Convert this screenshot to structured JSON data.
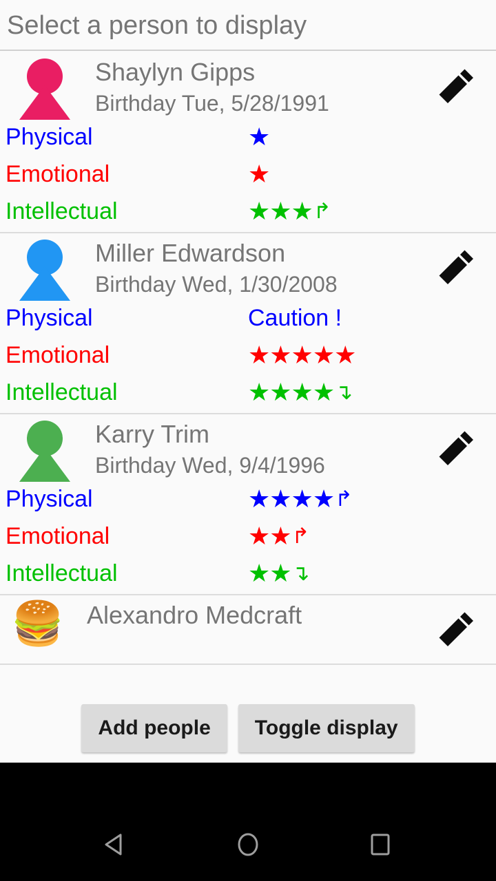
{
  "header": {
    "title": "Select a person to display"
  },
  "attributes": {
    "physical_label": "Physical",
    "emotional_label": "Emotional",
    "intellectual_label": "Intellectual",
    "physical_color": "#0000FF",
    "emotional_color": "#FF0000",
    "intellectual_color": "#00C000"
  },
  "icons": {
    "edit": "pencil-icon",
    "arrow_up": "↱",
    "arrow_down": "↴",
    "star": "★",
    "nav_back": "back-triangle-icon",
    "nav_home": "home-circle-icon",
    "nav_recents": "recents-square-icon"
  },
  "people": [
    {
      "name": "Shaylyn Gipps",
      "birthday": "Birthday Tue, 5/28/1991",
      "avatar_type": "person",
      "avatar_color": "#E91E63",
      "ratings": {
        "physical": {
          "stars": "★",
          "arrow": "",
          "caution": ""
        },
        "emotional": {
          "stars": "★",
          "arrow": "",
          "caution": ""
        },
        "intellectual": {
          "stars": "★★★",
          "arrow": "↱",
          "caution": ""
        }
      }
    },
    {
      "name": "Miller Edwardson",
      "birthday": "Birthday Wed, 1/30/2008",
      "avatar_type": "person",
      "avatar_color": "#2196F3",
      "ratings": {
        "physical": {
          "stars": "",
          "arrow": "",
          "caution": "Caution !"
        },
        "emotional": {
          "stars": "★★★★★",
          "arrow": "",
          "caution": ""
        },
        "intellectual": {
          "stars": "★★★★",
          "arrow": "↴",
          "caution": ""
        }
      }
    },
    {
      "name": "Karry Trim",
      "birthday": "Birthday Wed, 9/4/1996",
      "avatar_type": "person",
      "avatar_color": "#4CAF50",
      "ratings": {
        "physical": {
          "stars": "★★★★",
          "arrow": "↱",
          "caution": ""
        },
        "emotional": {
          "stars": "★★",
          "arrow": "↱",
          "caution": ""
        },
        "intellectual": {
          "stars": "★★",
          "arrow": "↴",
          "caution": ""
        }
      }
    },
    {
      "name": "Alexandro Medcraft",
      "birthday": "",
      "avatar_type": "emoji",
      "avatar_emoji": "🍔",
      "avatar_color": "",
      "ratings": {
        "physical": {
          "stars": "",
          "arrow": "",
          "caution": ""
        },
        "emotional": {
          "stars": "",
          "arrow": "",
          "caution": ""
        },
        "intellectual": {
          "stars": "",
          "arrow": "",
          "caution": ""
        }
      }
    }
  ],
  "buttons": {
    "add_people": "Add people",
    "toggle_display": "Toggle display"
  }
}
